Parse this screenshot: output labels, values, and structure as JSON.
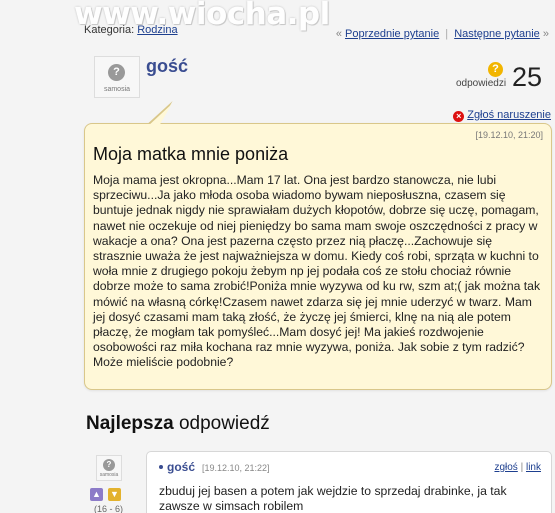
{
  "watermark": "www.wiocha.pl",
  "breadcrumb": {
    "label": "Kategoria:",
    "category": "Rodzina"
  },
  "nav": {
    "prev": "Poprzednie pytanie",
    "next": "Następne pytanie",
    "arrow_left": "«",
    "arrow_right": "»",
    "separator": "|"
  },
  "question": {
    "author": "gość",
    "avatar_text": "samosia",
    "answers_label": "odpowiedzi",
    "answers_count": "25",
    "report_label": "Zgłoś naruszenie",
    "date": "[19.12.10, 21:20]",
    "title": "Moja matka mnie poniża",
    "body": "Moja mama jest okropna...Mam 17 lat. Ona jest bardzo stanowcza, nie lubi sprzeciwu...Ja jako młoda osoba wiadomo bywam nieposłuszna, czasem się buntuje jednak nigdy nie sprawiałam dużych kłopotów, dobrze się uczę, pomagam, nawet nie oczekuje od niej pieniędzy bo sama mam swoje oszczędności z pracy w wakacje a ona? Ona jest pazerna często przez nią płaczę...Zachowuje się strasznie uważa że jest najważniejsza w domu. Kiedy coś robi, sprząta w kuchni to woła mnie z drugiego pokoju żebym np jej podała coś ze stołu chociaż równie dobrze może to sama zrobić!Poniża mnie wyzywa od ku rw, szm at;( jak można tak mówić na własną córkę!Czasem nawet zdarza się jej mnie uderzyć w twarz. Mam jej dosyć czasami mam taką złość, że życzę jej śmierci, klnę na nią ale potem płaczę, że mogłam tak pomyśleć...Mam dosyć jej! Ma jakieś rozdwojenie osobowości raz miła kochana raz mnie wyzywa, poniża. Jak sobie z tym radzić? Może mieliście podobnie?"
  },
  "best_answer": {
    "heading_bold": "Najlepsza",
    "heading_rest": "odpowiedź",
    "author": "gość",
    "avatar_text": "samosia",
    "date": "[19.12.10, 21:22]",
    "report_link": "zgłoś",
    "link_label": "link",
    "separator": "|",
    "votes": "(16 - 6)",
    "text": "zbuduj jej basen a potem jak wejdzie to sprzedaj drabinke, ja tak zawsze w simsach robilem"
  },
  "colors": {
    "accent": "#3a4d91",
    "bubble": "#fff8d8",
    "link": "#1d3f8f"
  }
}
